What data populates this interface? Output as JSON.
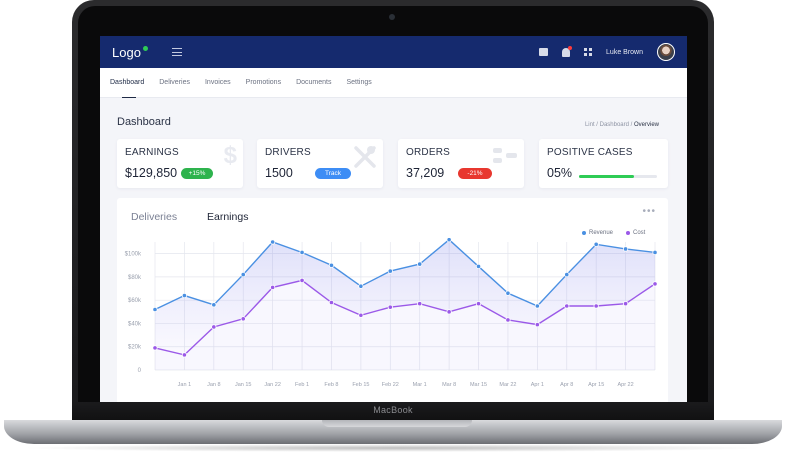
{
  "device": {
    "brand_label": "MacBook"
  },
  "header": {
    "logo": "Logo",
    "user_name": "Luke Brown",
    "icons": [
      "menu-icon",
      "mail-icon",
      "bell-icon",
      "apps-grid-icon"
    ]
  },
  "tabs": [
    {
      "label": "Dashboard",
      "active": true
    },
    {
      "label": "Deliveries",
      "active": false
    },
    {
      "label": "Invoices",
      "active": false
    },
    {
      "label": "Promotions",
      "active": false
    },
    {
      "label": "Documents",
      "active": false
    },
    {
      "label": "Settings",
      "active": false
    }
  ],
  "page": {
    "title": "Dashboard",
    "breadcrumb": {
      "path": "Lint / Dashboard / ",
      "current": "Overview"
    }
  },
  "cards": {
    "earnings": {
      "title": "EARNINGS",
      "value": "$129,850",
      "badge": "+15%",
      "badge_color": "#2eb34d",
      "icon": "dollar-icon"
    },
    "drivers": {
      "title": "DRIVERS",
      "value": "1500",
      "badge": "Track",
      "badge_color": "#3d8df5",
      "icon": "tools-icon"
    },
    "orders": {
      "title": "ORDERS",
      "value": "37,209",
      "badge": "-21%",
      "badge_color": "#e8372f",
      "icon": "flow-icon"
    },
    "positive_cases": {
      "title": "POSITIVE CASES",
      "value": "05%",
      "progress": 0.7,
      "progress_color": "#2ecc55"
    }
  },
  "chart_tabs": [
    {
      "label": "Deliveries",
      "active": false
    },
    {
      "label": "Earnings",
      "active": true
    }
  ],
  "chart_data": {
    "type": "line",
    "x": [
      "Jan 1",
      "Jan 8",
      "Jan 15",
      "Jan 22",
      "Feb 1",
      "Feb 8",
      "Feb 15",
      "Feb 22",
      "Mar 1",
      "Mar 8",
      "Mar 15",
      "Mar 22",
      "Apr 1",
      "Apr 8",
      "Apr 15",
      "Apr 22"
    ],
    "y_ticks": [
      "0",
      "$20k",
      "$40k",
      "$60k",
      "$80k",
      "$100k"
    ],
    "ylim": [
      0,
      110
    ],
    "grid": true,
    "legend_position": "top-right",
    "series": [
      {
        "name": "Revenue",
        "color": "#4a90e2",
        "values": [
          52,
          64,
          56,
          82,
          110,
          101,
          90,
          72,
          85,
          91,
          112,
          89,
          66,
          55,
          82,
          108,
          104,
          101
        ]
      },
      {
        "name": "Cost",
        "color": "#9b59e8",
        "values": [
          19,
          13,
          37,
          44,
          71,
          77,
          58,
          47,
          54,
          57,
          50,
          57,
          43,
          39,
          55,
          55,
          57,
          74
        ]
      }
    ]
  }
}
